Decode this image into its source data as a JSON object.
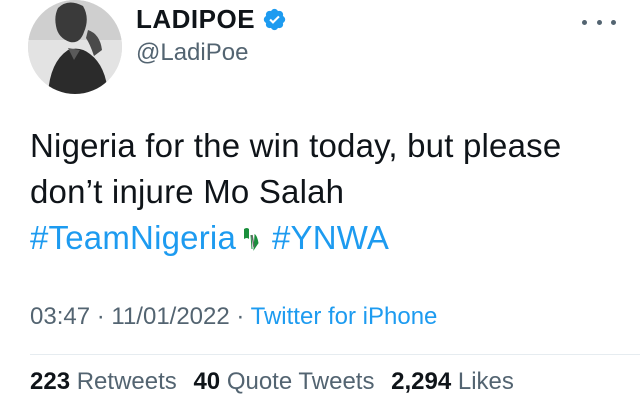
{
  "author": {
    "display_name": "LADIPOE",
    "handle": "@LadiPoe",
    "verified": true,
    "avatar_icon": "profile-photo"
  },
  "more_icon": "more-horizontal-icon",
  "tweet": {
    "line1": "Nigeria for the win today, but please",
    "line2": "don’t injure Mo Salah",
    "hashtag1": "#TeamNigeria",
    "hashtag2": "#YNWA",
    "flag_icon": "nigeria-flag-icon"
  },
  "meta": {
    "time": "03:47",
    "separator": " · ",
    "date": "11/01/2022",
    "source": "Twitter for iPhone"
  },
  "stats": {
    "retweets_count": "223",
    "retweets_label": "Retweets",
    "quotes_count": "40",
    "quotes_label": "Quote Tweets",
    "likes_count": "2,294",
    "likes_label": "Likes"
  },
  "colors": {
    "accent": "#1d9bf0",
    "secondary_text": "#536471",
    "primary_text": "#0f1419"
  }
}
